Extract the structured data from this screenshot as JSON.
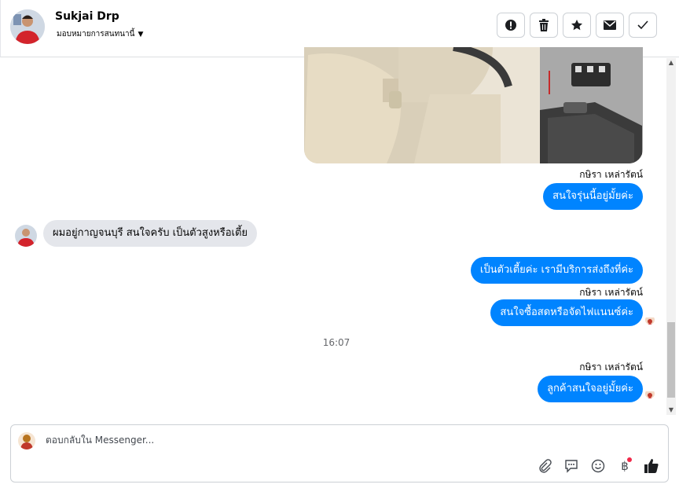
{
  "header": {
    "contact_name": "Sukjai Drp",
    "assign_label": "มอบหมายการสนทนานี้",
    "actions": [
      "mark-spam-icon",
      "delete-icon",
      "star-icon",
      "mark-unread-icon",
      "mark-done-icon"
    ]
  },
  "messages": {
    "sender_1": "กษิรา เหล่ารัตน์",
    "out_1": "สนใจรุ่นนี้อยู่มั้ยค่ะ",
    "in_1": "ผมอยู่กาญจนบุรี สนใจครับ เป็นตัวสูงหรือเตี้ย",
    "out_2": "เป็นตัวเตี้ยค่ะ เรามีบริการส่งถึงที่ค่ะ",
    "sender_2": "กษิรา เหล่ารัตน์",
    "out_3": "สนใจซื้อสดหรือจัดไฟแนนซ์ค่ะ",
    "timestamp": "16:07",
    "sender_3": "กษิรา เหล่ารัตน์",
    "out_4": "ลูกค้าสนใจอยู่มั้ยค่ะ"
  },
  "composer": {
    "placeholder": "ตอบกลับใน Messenger...",
    "tools": [
      "attach-icon",
      "saved-reply-icon",
      "emoji-icon",
      "payment-icon",
      "like-icon"
    ]
  },
  "colors": {
    "accent": "#0084ff",
    "incoming": "#e4e6eb",
    "notification": "#f02849"
  }
}
